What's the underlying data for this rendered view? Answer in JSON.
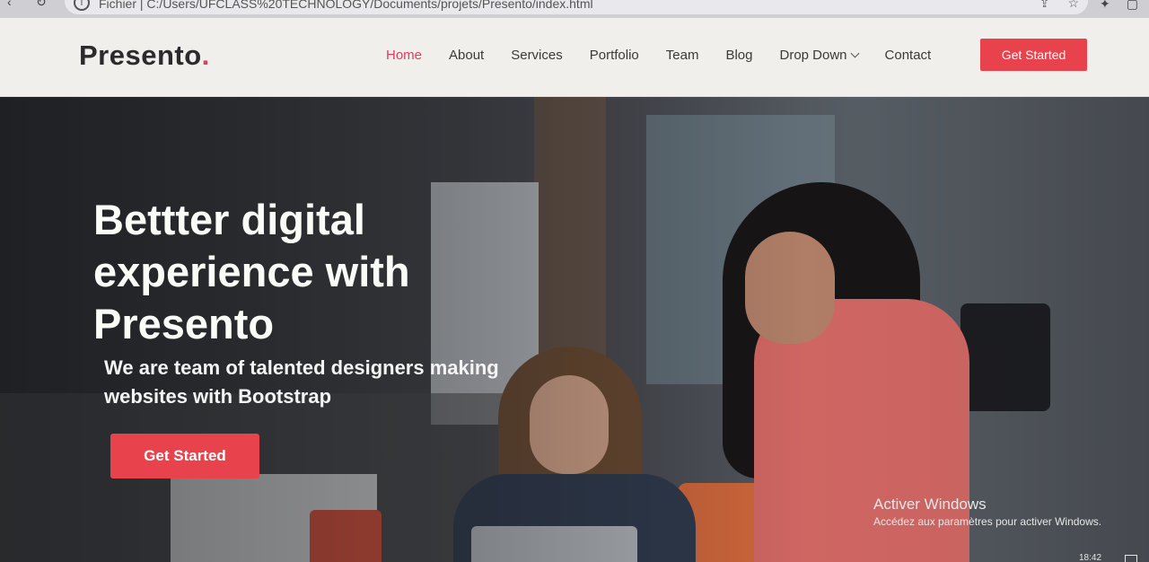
{
  "browser": {
    "info_icon": "info-icon",
    "address_text": "Fichier  |  C:/Users/UFCLASS%20TECHNOLOGY/Documents/projets/Presento/index.html"
  },
  "site": {
    "logo_text": "Presento",
    "logo_dot": ".",
    "nav": {
      "home": "Home",
      "about": "About",
      "services": "Services",
      "portfolio": "Portfolio",
      "team": "Team",
      "blog": "Blog",
      "dropdown": "Drop Down",
      "contact": "Contact"
    },
    "header_cta": "Get Started",
    "accent_color": "#e8424d"
  },
  "hero": {
    "title": "Bettter digital experience with Presento",
    "subtitle": "We are team of talented designers making websites with Bootstrap",
    "cta": "Get Started"
  },
  "windows": {
    "activate_title": "Activer Windows",
    "activate_desc": "Accédez aux paramètres pour activer Windows.",
    "clock": "18:42"
  }
}
